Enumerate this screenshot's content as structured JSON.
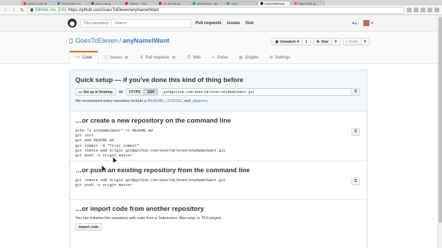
{
  "browser": {
    "tabs": [
      {
        "label": "How to test wi",
        "color": "#e44"
      },
      {
        "label": "TRAINING no",
        "color": "#1e90ff"
      },
      {
        "label": "atom setup -",
        "color": "#666"
      },
      {
        "label": "Videos - You",
        "color": "#e22"
      },
      {
        "label": "An introducti",
        "color": "#c33"
      },
      {
        "label": "WebStorm: Jav",
        "color": "#3a3"
      },
      {
        "label": "Atom",
        "color": "#5a5"
      },
      {
        "label": "GoesToEleven",
        "color": "#222",
        "active": true
      },
      {
        "label": "https://talk.gi",
        "color": "#e66"
      }
    ],
    "omnibox": {
      "ev_label": "GitHub, Inc. [US]",
      "url": "https://github.com/GoesToEleven/anyNameIWant"
    }
  },
  "header": {
    "search_scope": "This repository",
    "search_placeholder": "Search",
    "nav": [
      "Pull requests",
      "Issues",
      "Gist"
    ],
    "plus": "+",
    "caret": "▾"
  },
  "repo": {
    "owner": "GoesToEleven",
    "separator": "/",
    "name": "anyNameIWant",
    "unwatch_label": "Unwatch",
    "unwatch_count": "1",
    "star_label": "Star",
    "star_count": "0",
    "fork_label": "Fork",
    "fork_count": "0",
    "tabs": [
      {
        "label": "Code",
        "icon": "<>",
        "count": null,
        "selected": true
      },
      {
        "label": "Issues",
        "icon": "ⓘ",
        "count": "0"
      },
      {
        "label": "Pull requests",
        "icon": "⇅",
        "count": "0"
      },
      {
        "label": "Wiki",
        "icon": "☰",
        "count": null
      },
      {
        "label": "Pulse",
        "icon": "∿",
        "count": null
      },
      {
        "label": "Graphs",
        "icon": "▥",
        "count": null
      },
      {
        "label": "Settings",
        "icon": "⚙",
        "count": null
      }
    ]
  },
  "setup": {
    "heading": "Quick setup — if you've done this kind of thing before",
    "desktop_button": "Set up in Desktop",
    "or": "or",
    "https_label": "HTTPS",
    "ssh_label": "SSH",
    "clone_url": "git@github.com:GoesToEleven/anyNameIWant.git",
    "recommend_prefix": "We recommend every repository include a",
    "readme": "README",
    "comma": ",",
    "license": "LICENSE",
    "and": ", and",
    "gitignore": ".gitignore",
    "period": "."
  },
  "create": {
    "heading": "…or create a new repository on the command line",
    "code": "echo \"# anyNameIWant\" >> README.md\ngit init\ngit add README.md\ngit commit -m \"first commit\"\ngit remote add origin git@github.com:GoesToEleven/anyNameIWant.git\ngit push -u origin master"
  },
  "push": {
    "heading": "…or push an existing repository from the command line",
    "code": "git remote add origin git@github.com:GoesToEleven/anyNameIWant.git\ngit push -u origin master"
  },
  "import": {
    "heading": "…or import code from another repository",
    "description": "You can initialize this repository with code from a Subversion, Mercurial, or TFS project.",
    "button": "Import code"
  }
}
